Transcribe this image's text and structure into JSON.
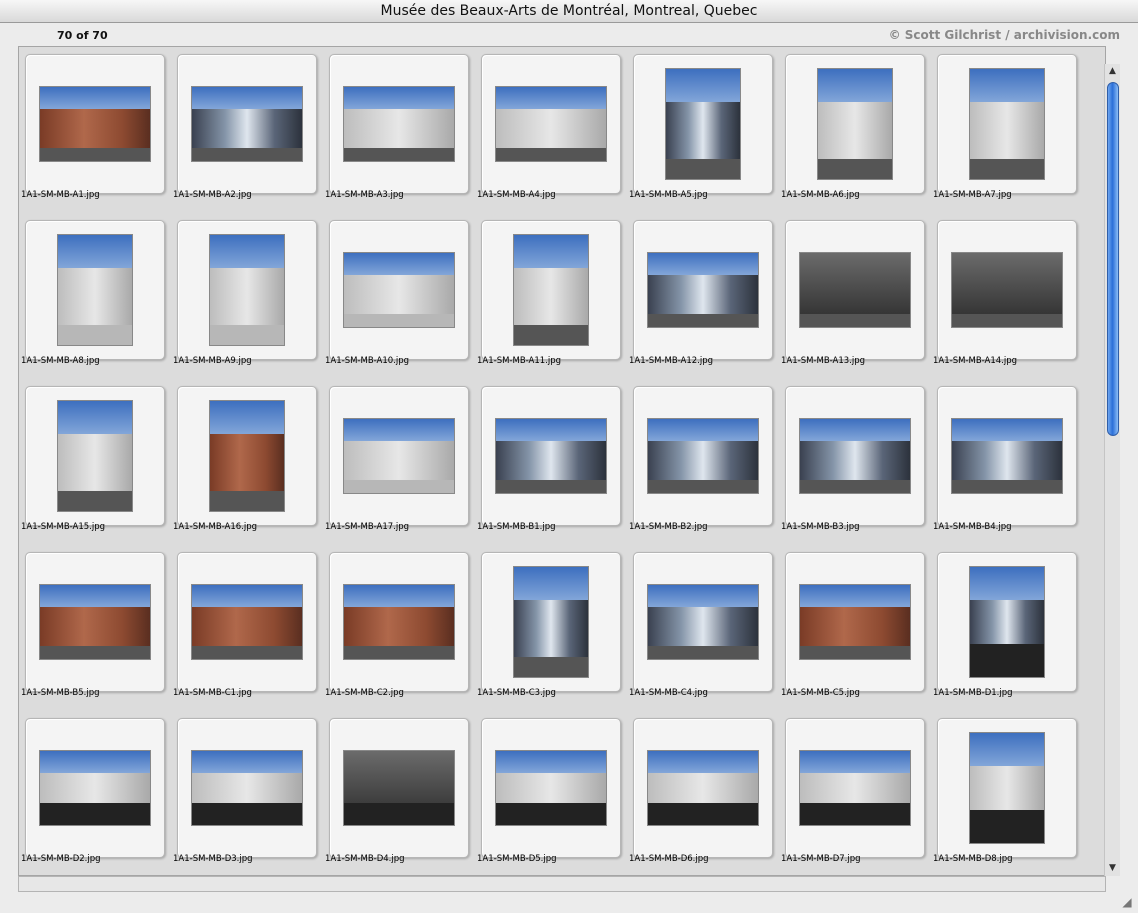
{
  "window": {
    "title": "Musée des Beaux-Arts de Montréal, Montreal, Quebec"
  },
  "info": {
    "count": "70 of 70",
    "credit": "© Scott Gilchrist / archivision.com"
  },
  "thumbnails": [
    {
      "label": "1A1-SM-MB-A1.jpg"
    },
    {
      "label": "1A1-SM-MB-A2.jpg"
    },
    {
      "label": "1A1-SM-MB-A3.jpg"
    },
    {
      "label": "1A1-SM-MB-A4.jpg"
    },
    {
      "label": "1A1-SM-MB-A5.jpg"
    },
    {
      "label": "1A1-SM-MB-A6.jpg"
    },
    {
      "label": "1A1-SM-MB-A7.jpg"
    },
    {
      "label": "1A1-SM-MB-A8.jpg"
    },
    {
      "label": "1A1-SM-MB-A9.jpg"
    },
    {
      "label": "1A1-SM-MB-A10.jpg"
    },
    {
      "label": "1A1-SM-MB-A11.jpg"
    },
    {
      "label": "1A1-SM-MB-A12.jpg"
    },
    {
      "label": "1A1-SM-MB-A13.jpg"
    },
    {
      "label": "1A1-SM-MB-A14.jpg"
    },
    {
      "label": "1A1-SM-MB-A15.jpg"
    },
    {
      "label": "1A1-SM-MB-A16.jpg"
    },
    {
      "label": "1A1-SM-MB-A17.jpg"
    },
    {
      "label": "1A1-SM-MB-B1.jpg"
    },
    {
      "label": "1A1-SM-MB-B2.jpg"
    },
    {
      "label": "1A1-SM-MB-B3.jpg"
    },
    {
      "label": "1A1-SM-MB-B4.jpg"
    },
    {
      "label": "1A1-SM-MB-B5.jpg"
    },
    {
      "label": "1A1-SM-MB-C1.jpg"
    },
    {
      "label": "1A1-SM-MB-C2.jpg"
    },
    {
      "label": "1A1-SM-MB-C3.jpg"
    },
    {
      "label": "1A1-SM-MB-C4.jpg"
    },
    {
      "label": "1A1-SM-MB-C5.jpg"
    },
    {
      "label": "1A1-SM-MB-D1.jpg"
    },
    {
      "label": "1A1-SM-MB-D2.jpg"
    },
    {
      "label": "1A1-SM-MB-D3.jpg"
    },
    {
      "label": "1A1-SM-MB-D4.jpg"
    },
    {
      "label": "1A1-SM-MB-D5.jpg"
    },
    {
      "label": "1A1-SM-MB-D6.jpg"
    },
    {
      "label": "1A1-SM-MB-D7.jpg"
    },
    {
      "label": "1A1-SM-MB-D8.jpg"
    }
  ]
}
